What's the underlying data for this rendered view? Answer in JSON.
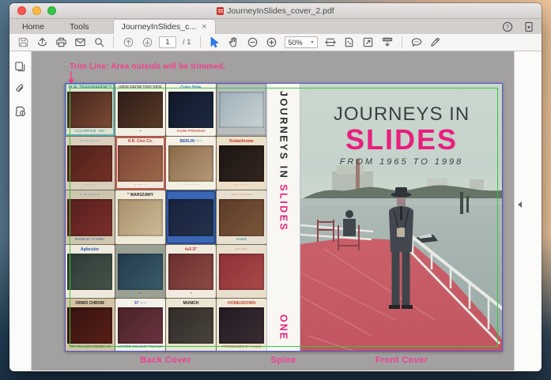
{
  "window": {
    "title": "JourneyInSlides_cover_2.pdf",
    "tabs": {
      "home": "Home",
      "tools": "Tools",
      "doc": "JourneyInSlides_c...",
      "close": "×"
    },
    "toolbar": {
      "page_current": "1",
      "page_total": "/ 1",
      "zoom_level": "50%",
      "zoom_caret": "▾"
    },
    "help_glyph": "?"
  },
  "colors": {
    "accent_pink": "#ee3e93",
    "title_pink": "#e81f7e",
    "trim_green": "#35c93c",
    "bleed_blue": "#5553d6",
    "canvas_grey": "#a3a1a0",
    "deck_red": "#c5525f"
  },
  "document": {
    "trim_note": "Trim Line: Area outside will be trimmed.",
    "labels": {
      "back": "Back Cover",
      "spine": "Spine",
      "front": "Front Cover"
    },
    "spine": {
      "title_black": "JOURNEYS IN ",
      "title_pink": "SLIDES",
      "volume": "ONE"
    },
    "front": {
      "title1": "JOURNEYS IN",
      "title2": "SLIDES",
      "subtitle": "FROM 1965 TO 1998"
    },
    "slides": [
      {
        "frame": "#e0e1d3",
        "border": "#5fb3b0",
        "top": "·M.M· TRANSPARENCY",
        "tc": "#2e8f8a",
        "img1": "#46251f",
        "img2": "#7c4a33",
        "bottom": "· COLORFILM · NO ·",
        "bc": "#2e8f8a"
      },
      {
        "frame": "#f2eee2",
        "border": "",
        "top": "VIEW FROM THIS SIDE",
        "tc": "#6a665e",
        "img1": "#2e1d18",
        "img2": "#5a3a28",
        "bottom": "▪",
        "bc": "#333333"
      },
      {
        "frame": "#f7f3e8",
        "border": "",
        "top": "Color Slide",
        "tc": "#2b7bd4",
        "img1": "#10182a",
        "img2": "#1c2a40",
        "bottom": "Kodak PREMIUM",
        "bc": "#b8342a"
      },
      {
        "frame": "#babebf",
        "border": "#a3a7a8",
        "top": "",
        "tc": "#888888",
        "img1": "#9fb0ba",
        "img2": "#c7d2d4",
        "bottom": "",
        "bc": "#888888"
      },
      {
        "frame": "#d9cfbc",
        "border": "",
        "top": "·· ···· ···· ··",
        "tc": "#4a6ab0",
        "img1": "#4e1f1a",
        "img2": "#733227",
        "bottom": "··· ·· ···",
        "bc": "#4a6ab0"
      },
      {
        "frame": "#f3e9dc",
        "border": "#c9554a",
        "top": "H.R. Cine Co.",
        "tc": "#c04438",
        "img1": "#7c4334",
        "img2": "#9c6a4a",
        "bottom": "·· ····· ··",
        "bc": "#c04438"
      },
      {
        "frame": "#f4f0e4",
        "border": "",
        "top": "BERLIN ·····",
        "tc": "#2b57b0",
        "img1": "#8a6a48",
        "img2": "#b59878",
        "bottom": "··· ······ ···",
        "bc": "#888888"
      },
      {
        "frame": "#ecdfc8",
        "border": "",
        "top": "Kodachrome",
        "tc": "#c4302a",
        "img1": "#1c1512",
        "img2": "#332620",
        "bottom": "····· ·· ·····",
        "bc": "#c4302a"
      },
      {
        "frame": "#cfc5ad",
        "border": "",
        "top": "·· ··· · ···· ··",
        "tc": "#3a5ea8",
        "img1": "#551e1e",
        "img2": "#7c2f2c",
        "bottom": "MADE BY ⬭ KIMA",
        "bc": "#3a5ea8"
      },
      {
        "frame": "#efe9da",
        "border": "",
        "top": "\" WARSZAWY",
        "tc": "#2a2a2a",
        "img1": "#a8906c",
        "img2": "#cdbb96",
        "bottom": "",
        "bc": "#888888"
      },
      {
        "frame": "#3a67b5",
        "border": "#2a4a8c",
        "top": "",
        "tc": "#ffffff",
        "img1": "#18223c",
        "img2": "#24324e",
        "bottom": "",
        "bc": "#ffffff"
      },
      {
        "frame": "#e7e0d0",
        "border": "",
        "top": "····· ··········",
        "tc": "#c04438",
        "img1": "#5c3c28",
        "img2": "#7a563a",
        "bottom": "Kodak",
        "bc": "#1a8a96"
      },
      {
        "frame": "#eee9dc",
        "border": "",
        "top": "Agfacolor",
        "tc": "#2b57b0",
        "img1": "#2c3a34",
        "img2": "#44544a",
        "bottom": "",
        "bc": "#888888"
      },
      {
        "frame": "#9aa092",
        "border": "",
        "top": "",
        "tc": "#555555",
        "img1": "#233c4c",
        "img2": "#3a5a6a",
        "bottom": "▪",
        "bc": "#444444"
      },
      {
        "frame": "#f0ebde",
        "border": "",
        "top": "№5  2Г",
        "tc": "#c03a30",
        "img1": "#6a2f30",
        "img2": "#8c4a45",
        "bottom": "▪",
        "bc": "#444444"
      },
      {
        "frame": "#e9dfcd",
        "border": "",
        "top": "··· ·····",
        "tc": "#c04438",
        "img1": "#8c3038",
        "img2": "#a84a4a",
        "bottom": "",
        "bc": "#888888"
      },
      {
        "frame": "#d6c4a4",
        "border": "",
        "top": "ORWO CHROM",
        "tc": "#1f1f1f",
        "img1": "#38120f",
        "img2": "#571f18",
        "bottom": "TIFA TRANSPARENCY  84",
        "bc": "#3a3a3a"
      },
      {
        "frame": "#f4f1e8",
        "border": "",
        "top": "37 ·····",
        "tc": "#2b57b0",
        "img1": "#4a2228",
        "img2": "#6b3440",
        "bottom": "UNITED COLOUR FILM EST.",
        "bc": "#2b57b0"
      },
      {
        "frame": "#ece5d1",
        "border": "",
        "top": "MUNICH",
        "tc": "#1a1a1a",
        "img1": "#2f2b28",
        "img2": "#4a443c",
        "bottom": "",
        "bc": "#888888"
      },
      {
        "frame": "#f0e9d7",
        "border": "",
        "top": "·HOMEGROWN·",
        "tc": "#c04438",
        "img1": "#241c22",
        "img2": "#3a2c34",
        "bottom": "PROCESSED BY Kodak",
        "bc": "#c04438"
      }
    ]
  }
}
